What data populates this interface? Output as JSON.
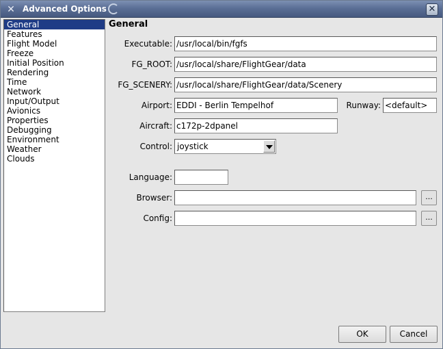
{
  "window": {
    "title": "Advanced Options",
    "app_icon": "x-app-icon",
    "swirl_icon": "swirl-icon",
    "close_glyph": "✕"
  },
  "categories": [
    {
      "label": "General",
      "selected": true
    },
    {
      "label": "Features"
    },
    {
      "label": "Flight Model"
    },
    {
      "label": "Freeze"
    },
    {
      "label": "Initial Position"
    },
    {
      "label": "Rendering"
    },
    {
      "label": "Time"
    },
    {
      "label": "Network"
    },
    {
      "label": "Input/Output"
    },
    {
      "label": "Avionics"
    },
    {
      "label": "Properties"
    },
    {
      "label": "Debugging"
    },
    {
      "label": "Environment"
    },
    {
      "label": "Weather"
    },
    {
      "label": "Clouds"
    }
  ],
  "general": {
    "title": "General",
    "executable_label": "Executable:",
    "executable_value": "/usr/local/bin/fgfs",
    "fgroot_label": "FG_ROOT:",
    "fgroot_value": "/usr/local/share/FlightGear/data",
    "fgscenery_label": "FG_SCENERY:",
    "fgscenery_value": "/usr/local/share/FlightGear/data/Scenery",
    "airport_label": "Airport:",
    "airport_value": "EDDI - Berlin Tempelhof",
    "runway_label": "Runway:",
    "runway_value": "<default>",
    "aircraft_label": "Aircraft:",
    "aircraft_value": "c172p-2dpanel",
    "control_label": "Control:",
    "control_value": "joystick",
    "language_label": "Language:",
    "language_value": "",
    "browser_label": "Browser:",
    "browser_value": "",
    "browser_btn": "...",
    "config_label": "Config:",
    "config_value": "",
    "config_btn": "..."
  },
  "buttons": {
    "ok": "OK",
    "cancel": "Cancel"
  },
  "colors": {
    "selection": "#1f3c86",
    "titlebar": "#5b6f96"
  }
}
